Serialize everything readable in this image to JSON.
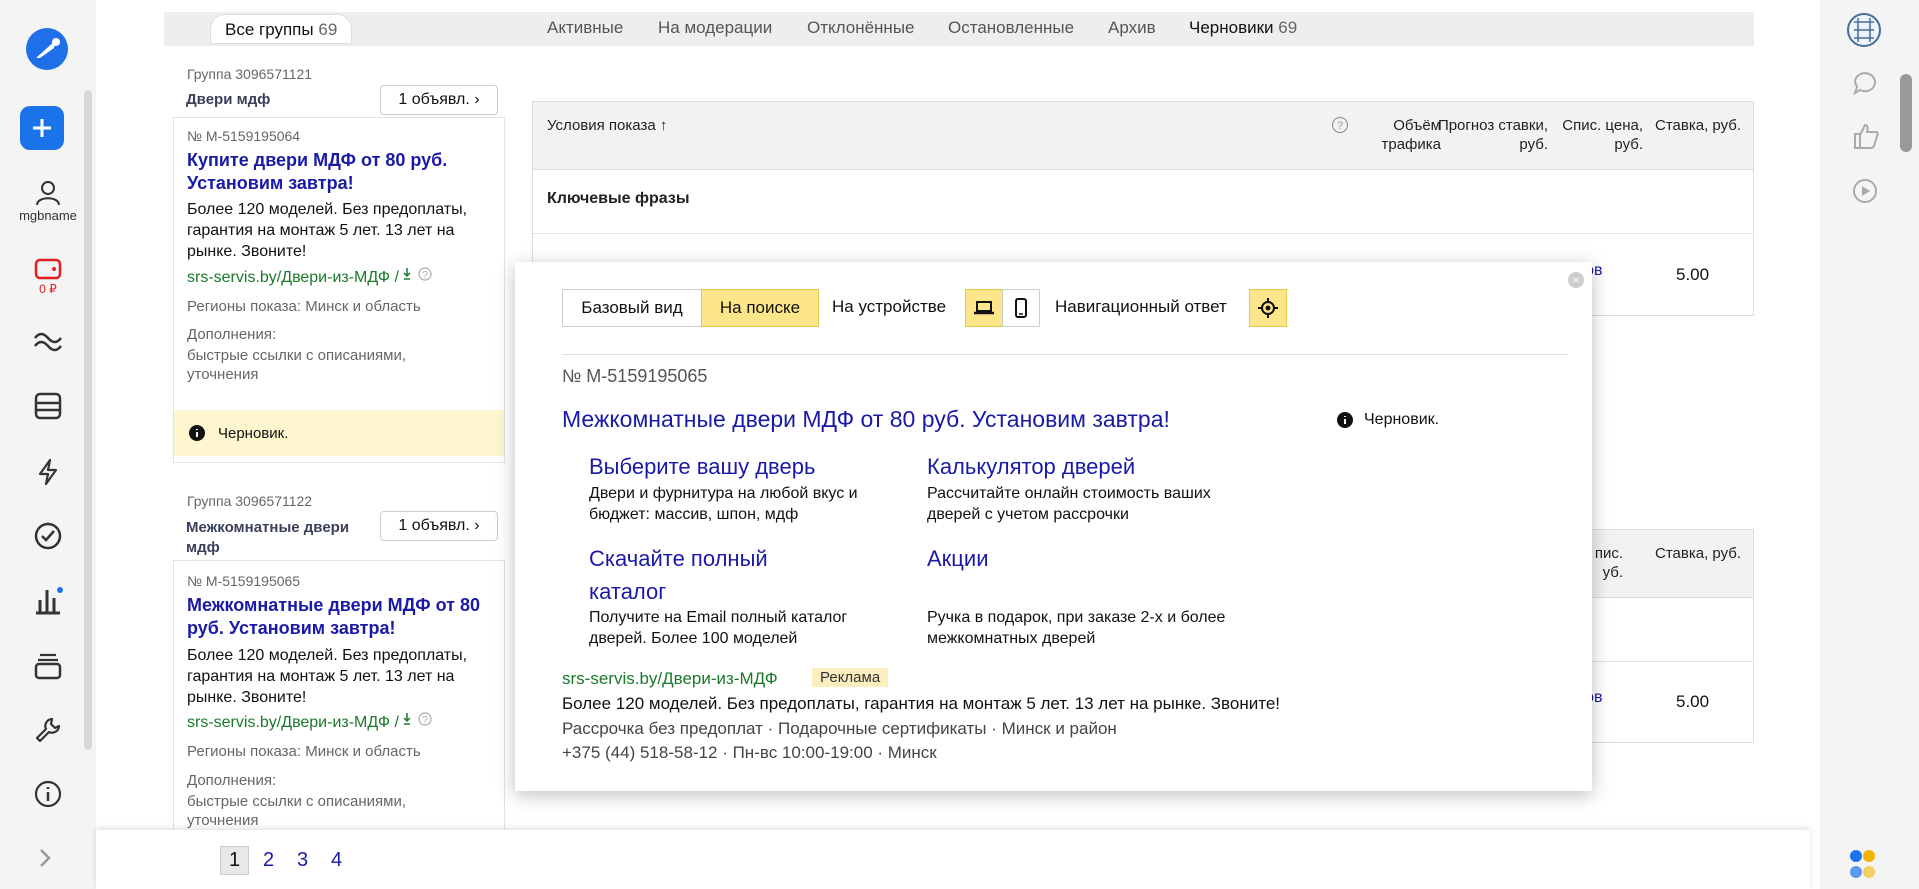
{
  "nav": {
    "user_label": "mgbname",
    "balance_label": "0 ₽"
  },
  "tabs": {
    "all_label": "Все группы",
    "all_count": "69",
    "items": [
      "Активные",
      "На модерации",
      "Отклонённые",
      "Остановленные",
      "Архив"
    ],
    "drafts_label": "Черновики",
    "drafts_count": "69"
  },
  "groups": [
    {
      "group_label": "Группа 3096571121",
      "group_name": "Двери мдф",
      "ads_button": "1 объявл. ›",
      "ad_number": "№ M-5159195064",
      "ad_title": "Купите двери МДФ от 80 руб. Установим завтра!",
      "ad_text": "Более 120 моделей. Без предоплаты, гарантия на монтаж 5 лет. 13 лет на рынке. Звоните!",
      "ad_url": "srs-servis.by/Двери-из-МДФ /",
      "regions": "Регионы показа: Минск и область",
      "extras_heading": "Дополнения:",
      "extras_text": "быстрые ссылки с описаниями, уточнения",
      "status": "Черновик."
    },
    {
      "group_label": "Группа 3096571122",
      "group_name": "Межкомнатные двери мдф",
      "ads_button": "1 объявл. ›",
      "ad_number": "№ M-5159195065",
      "ad_title": "Межкомнатные двери МДФ от 80 руб. Установим завтра!",
      "ad_text": "Более 120 моделей. Без предоплаты, гарантия на монтаж 5 лет. 13 лет на рынке. Звоните!",
      "ad_url": "srs-servis.by/Двери-из-МДФ /",
      "regions": "Регионы показа: Минск и область",
      "extras_heading": "Дополнения:",
      "extras_text": "быстрые ссылки с описаниями, уточнения"
    }
  ],
  "table": {
    "col_conditions": "Условия показа ↑",
    "col_volume": "Объём трафика",
    "col_forecast": "Прогноз ставки, руб.",
    "col_list_price": "Спис. цена, руб.",
    "col_list_price_short": "пис. уб.",
    "col_rate": "Ставка, руб.",
    "section_keywords": "Ключевые фразы",
    "row_link_fragment": "тов",
    "rate_value_1": "5.00",
    "rate_value_2": "5.00"
  },
  "popup": {
    "view_base": "Базовый вид",
    "view_search": "На поиске",
    "device_label": "На устройстве",
    "nav_answer_label": "Навигационный ответ",
    "close_symbol": "×",
    "ad_number": "№ M-5159195065",
    "title": "Межкомнатные двери МДФ от 80 руб. Установим завтра!",
    "status": "Черновик.",
    "sitelinks": [
      {
        "title": "Выберите вашу дверь",
        "desc": "Двери и фурнитура на любой вкус и бюджет: массив, шпон, мдф"
      },
      {
        "title": "Калькулятор дверей",
        "desc": "Рассчитайте онлайн стоимость ваших дверей с учетом рассрочки"
      },
      {
        "title": "Скачайте полный каталог",
        "desc": "Получите на Email полный каталог дверей. Более 100 моделей"
      },
      {
        "title": "Акции",
        "desc": "Ручка в подарок, при заказе 2-х и более межкомнатных дверей"
      }
    ],
    "url": "srs-servis.by/Двери-из-МДФ",
    "badge": "Реклама",
    "text": "Более 120 моделей. Без предоплаты, гарантия на монтаж 5 лет. 13 лет на рынке. Звоните!",
    "callouts": "Рассрочка без предоплат · Подарочные сертификаты · Минск и район",
    "contacts": "+375 (44) 518-58-12 · Пн-вс 10:00-19:00 · Минск"
  },
  "pagination": {
    "pages": [
      "1",
      "2",
      "3",
      "4"
    ],
    "current": "1"
  },
  "colors": {
    "accent": "#1a73e8",
    "link": "#1a1aa6",
    "url_green": "#1a7a2a",
    "highlight": "#fde68a"
  }
}
